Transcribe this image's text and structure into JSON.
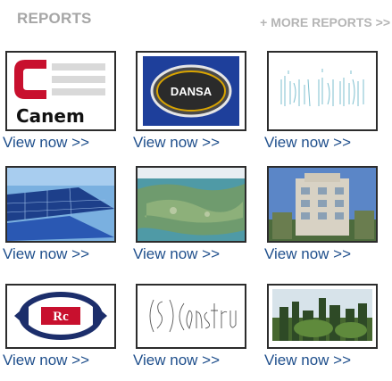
{
  "header": {
    "title": "REPORTS",
    "more_link": "+ MORE REPORTS >>"
  },
  "reports": [
    {
      "logo": "canem-logo",
      "logo_text": "Canem",
      "link": "View now >>"
    },
    {
      "logo": "dansa-logo",
      "logo_text": "DANSA",
      "link": "View now >>"
    },
    {
      "logo": "handwritten-title-logo",
      "link": "View now >>"
    },
    {
      "logo": "solar-panels-photo",
      "link": "View now >>"
    },
    {
      "logo": "aerial-landscape-photo",
      "link": "View now >>"
    },
    {
      "logo": "building-photo",
      "link": "View now >>"
    },
    {
      "logo": "rcs-logo",
      "logo_text": "Rc",
      "link": "View now >>"
    },
    {
      "logo": "csi-construction-logo",
      "logo_text": "CSI Construction",
      "link": "View now >>"
    },
    {
      "logo": "skyline-photo",
      "link": "View now >>"
    }
  ],
  "colors": {
    "title": "#a6a6a6",
    "more_link": "#b5b5b5",
    "view_link": "#1f4f8c",
    "thumb_border": "#2c2c2c"
  }
}
